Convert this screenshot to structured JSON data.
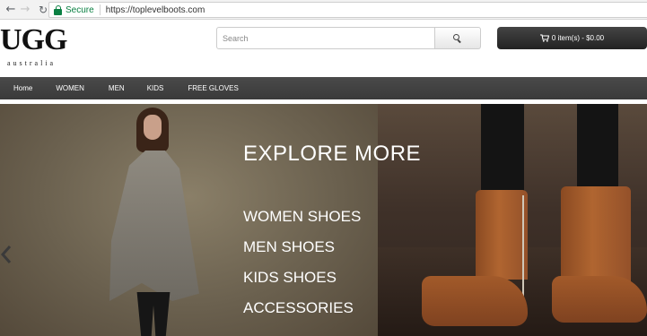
{
  "browser": {
    "secure_label": "Secure",
    "url": "https://toplevelboots.com"
  },
  "header": {
    "logo_text": "UGG",
    "logo_sub": "australia",
    "search_placeholder": "Search",
    "cart_label": "0 item(s) - $0.00"
  },
  "nav": {
    "items": [
      "Home",
      "WOMEN",
      "MEN",
      "KIDS",
      "FREE GLOVES"
    ]
  },
  "banner": {
    "heading": "EXPLORE MORE",
    "categories": [
      "WOMEN SHOES",
      "MEN SHOES",
      "KIDS SHOES",
      "ACCESSORIES"
    ]
  },
  "colors": {
    "nav_bg": "#404040",
    "cart_bg": "#2d2d2d",
    "secure_green": "#0b8043"
  }
}
